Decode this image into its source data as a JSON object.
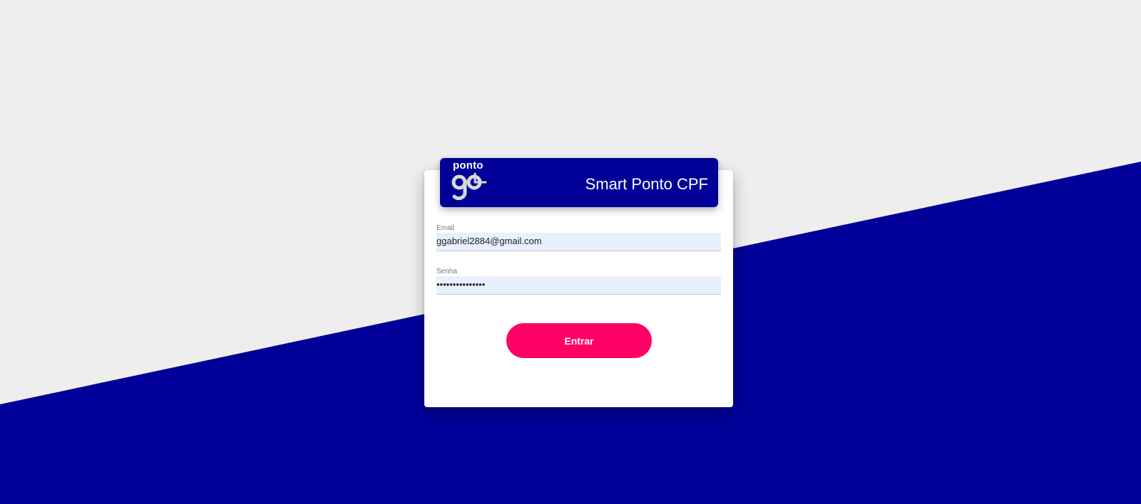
{
  "colors": {
    "background": "#eeeeee",
    "brand_blue": "#000099",
    "accent_pink": "#ff0066",
    "input_fill": "#e8f0fe"
  },
  "header": {
    "logo_text": "ponto",
    "logo_icon": "ponto-go-logo",
    "title": "Smart Ponto CPF"
  },
  "form": {
    "email": {
      "label": "Email",
      "value": "ggabriel2884@gmail.com"
    },
    "password": {
      "label": "Senha",
      "value": "•••••••••••••••"
    },
    "submit_label": "Entrar"
  }
}
